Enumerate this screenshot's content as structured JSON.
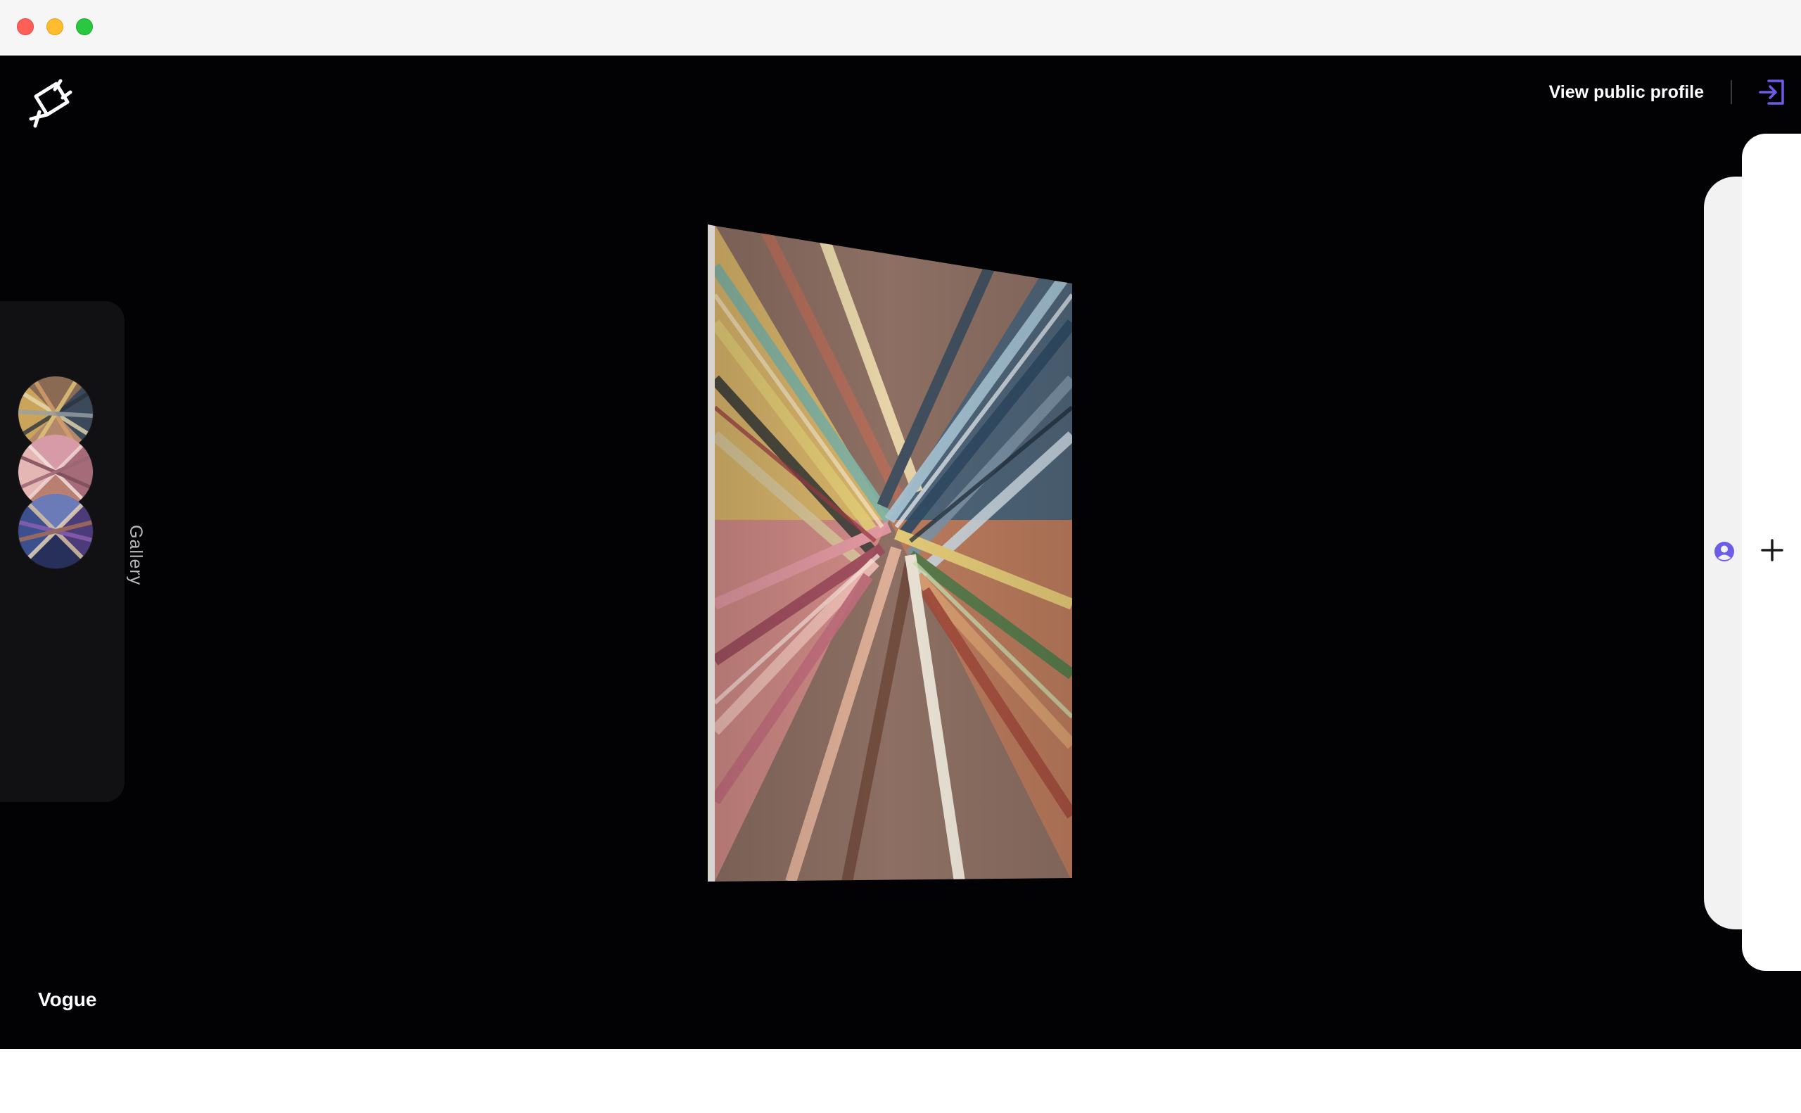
{
  "window": {
    "traffic_lights": [
      "close",
      "minimize",
      "zoom"
    ],
    "colors": {
      "close": "#ff5f57",
      "minimize": "#febc2e",
      "zoom": "#28c840"
    }
  },
  "header": {
    "logo_icon": "plug-icon",
    "profile_link": "View public profile",
    "signout_icon": "sign-out-icon",
    "accent_color": "#6c5ce7"
  },
  "gallery": {
    "label": "Gallery",
    "items": [
      {
        "icon": "collage-thumbnail-1"
      },
      {
        "icon": "collage-thumbnail-2"
      },
      {
        "icon": "collage-thumbnail-3"
      }
    ]
  },
  "artwork": {
    "title": "Vogue",
    "icon": "collage-artwork"
  },
  "side_panel": {
    "user_icon": "user-circle-icon",
    "add_icon": "plus-icon"
  }
}
